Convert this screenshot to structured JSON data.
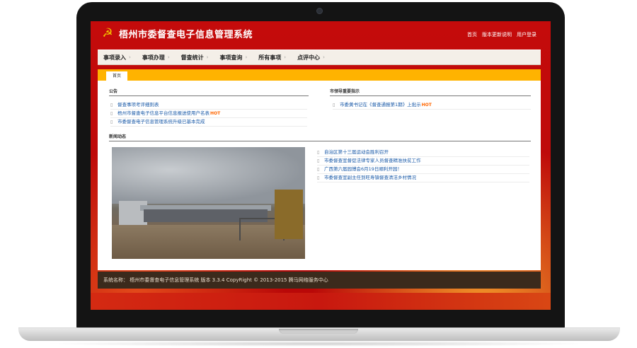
{
  "header": {
    "title": "梧州市委督查电子信息管理系统",
    "emblem": "☭",
    "links": [
      "首页",
      "版本更新说明",
      "用户登录"
    ]
  },
  "nav": {
    "items": [
      "事项录入",
      "事项办理",
      "督查统计",
      "事项查询",
      "所有事项",
      "点评中心"
    ],
    "arrow": "›"
  },
  "tabs": [
    "首页"
  ],
  "notices": {
    "title": "公告",
    "items": [
      {
        "text": "督查事项考评细则表",
        "hot": ""
      },
      {
        "text": "梧州市督查电子信息平台信息报送使用户名表",
        "hot": "HOT"
      },
      {
        "text": "市委督查电子信息管理系统升级已基本完成",
        "hot": ""
      }
    ]
  },
  "leader": {
    "title": "市领导重要指示",
    "items": [
      {
        "text": "市委黄书记在《督查通报第1期》上批示",
        "hot": "HOT"
      }
    ]
  },
  "news": {
    "title": "新闻动态",
    "items": [
      {
        "text": "自治区第十三届运动会胜利召开"
      },
      {
        "text": "市委督查室督促法律专家人员督查精准扶贫工作"
      },
      {
        "text": "广西第六届园博会6月19日顺利开园！"
      },
      {
        "text": "市委督查室副主任到旺寿镇督查清洁乡村情况"
      }
    ]
  },
  "footer": {
    "text": "系统名称： 梧州市委督查电子信息管理系统 版本 3.3.4 CopyRight © 2013-2015 腾马网络服务中心"
  },
  "colors": {
    "header_red": "#c40b0b",
    "tab_bar": "#ffb300",
    "link_blue": "#1a5aa8",
    "hot_orange": "#ff6600",
    "footer_brown": "#3b2a1c"
  }
}
